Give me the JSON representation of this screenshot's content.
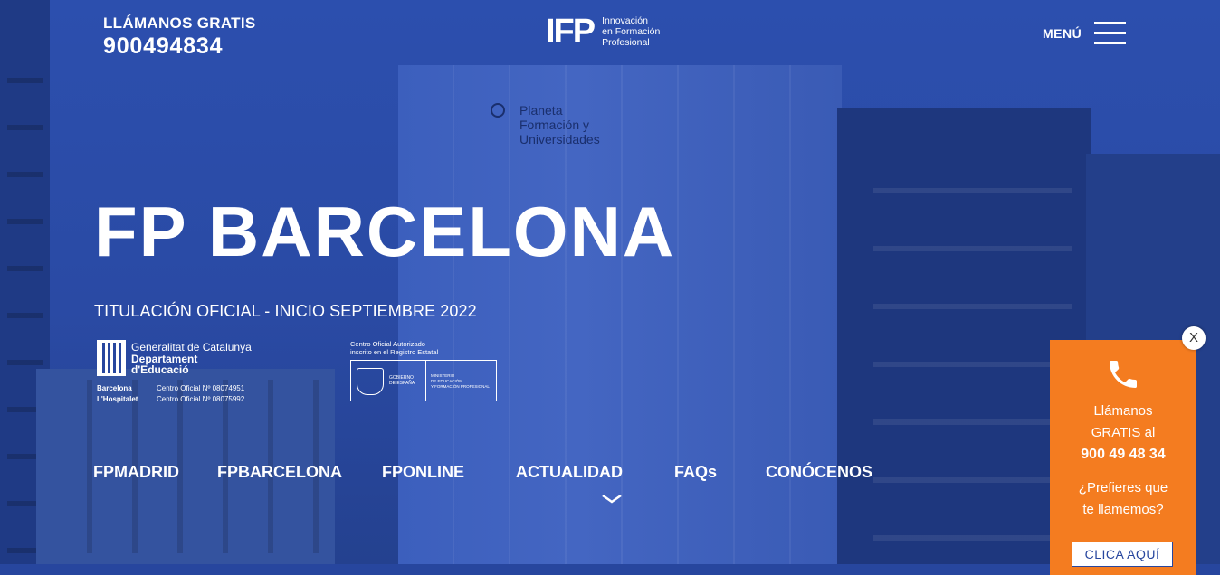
{
  "header": {
    "call_label": "LLÁMANOS GRATIS",
    "phone": "900494834",
    "logo_mark": "IFP",
    "logo_text": "Innovación\nen Formación\nProfesional",
    "menu_label": "MENÚ"
  },
  "background_sign": "Planeta\nFormación y\nUniversidades",
  "hero": {
    "title": "FP BARCELONA",
    "subtitle": "TITULACIÓN OFICIAL - INICIO SEPTIEMBRE 2022"
  },
  "accreditation": {
    "gencat_line1": "Generalitat de Catalunya",
    "gencat_line2": "Departament",
    "gencat_line3": "d'Educació",
    "offices": [
      {
        "city": "Barcelona",
        "label": "Centro Oficial Nº 08074951"
      },
      {
        "city": "L'Hospitalet",
        "label": "Centro Oficial Nº 08075992"
      }
    ],
    "ministry_top": "Centro Oficial Autorizado\ninscrito en el Registro Estatal",
    "gobierno": "GOBIERNO\nDE ESPAÑA",
    "ministerio": "MINISTERIO\nDE EDUCACIÓN\nY FORMACIÓN PROFESIONAL"
  },
  "nav": {
    "items": [
      "FPMADRID",
      "FPBARCELONA",
      "FPONLINE",
      "ACTUALIDAD",
      "FAQs",
      "CONÓCENOS"
    ]
  },
  "call_widget": {
    "line1": "Llámanos",
    "line2": "GRATIS al",
    "number": "900 49 48 34",
    "question1": "¿Prefieres que",
    "question2": "te llamemos?",
    "button": "CLICA AQUÍ",
    "close": "X",
    "icon": "phone-icon"
  },
  "colors": {
    "brand_blue": "#27469e",
    "widget_orange": "#f47c20"
  }
}
